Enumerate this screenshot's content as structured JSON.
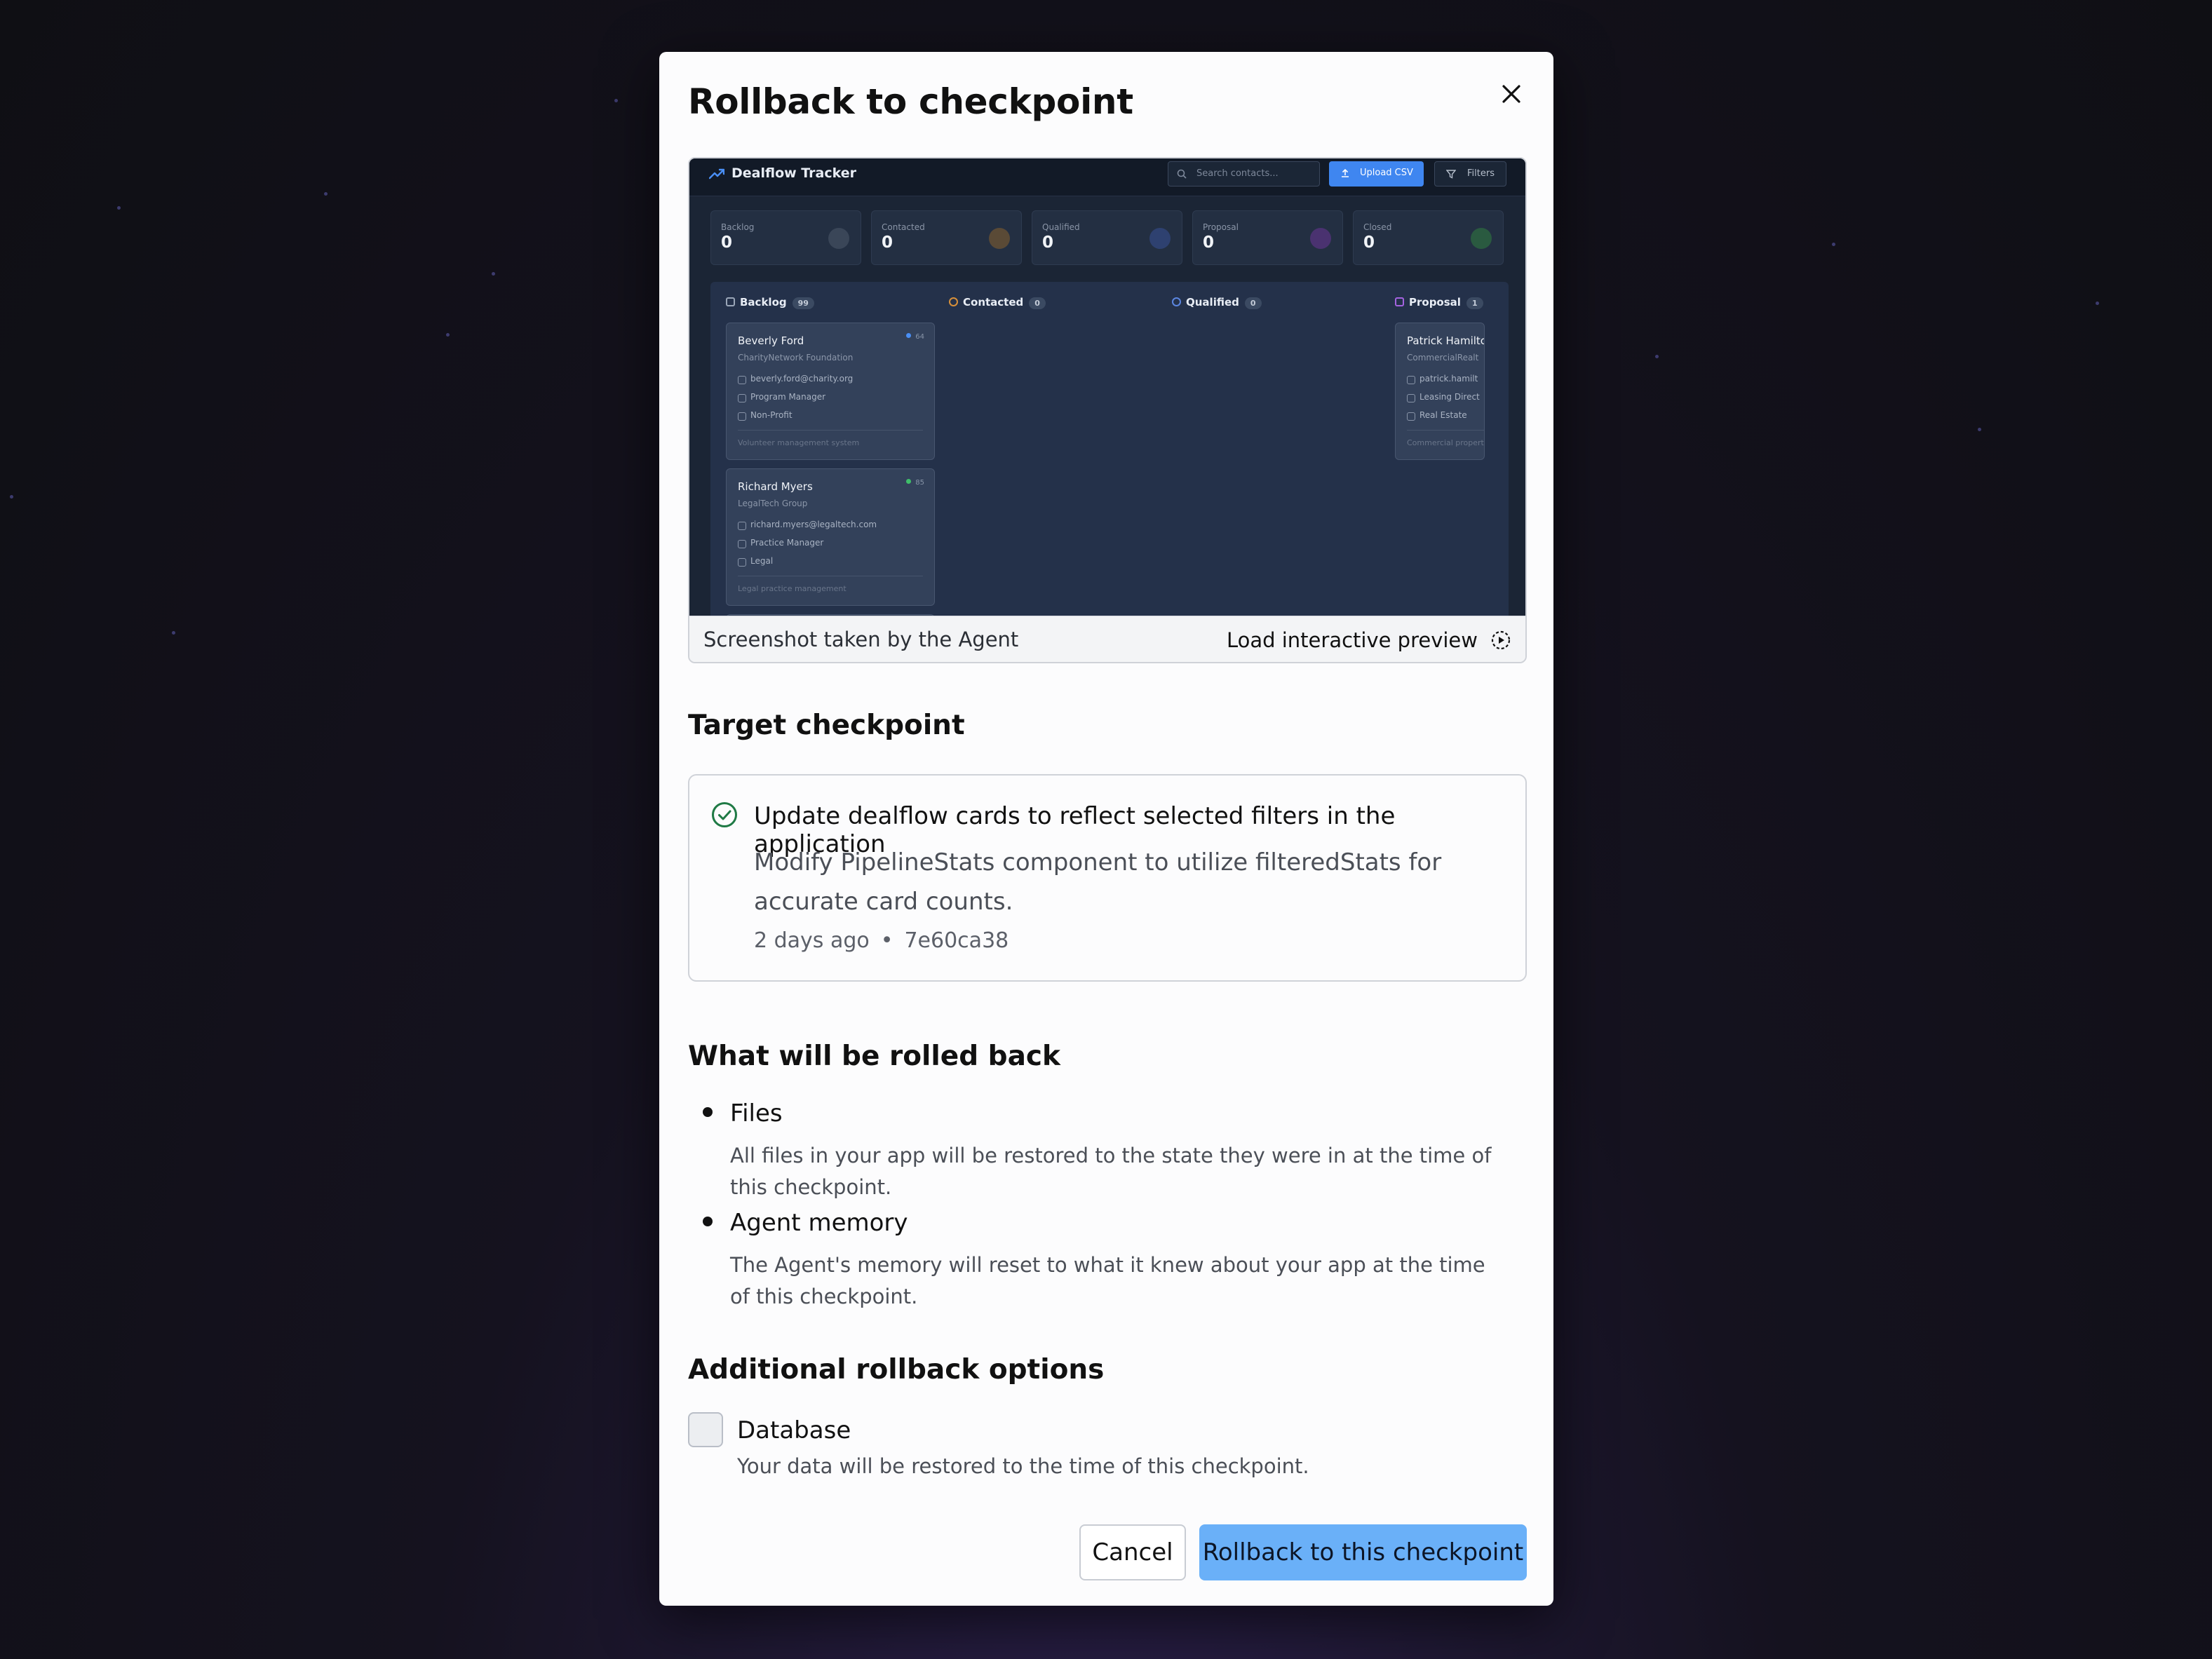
{
  "dialog": {
    "title": "Rollback to checkpoint",
    "close_icon": "close-icon"
  },
  "preview": {
    "caption": "Screenshot taken by the Agent",
    "load_label": "Load interactive preview",
    "load_icon": "play-circle-icon",
    "app": {
      "brand": "Dealflow Tracker",
      "search_placeholder": "Search contacts...",
      "upload_label": "Upload CSV",
      "filters_label": "Filters",
      "stats": [
        {
          "label": "Backlog",
          "value": "0",
          "color": "#6b7a90"
        },
        {
          "label": "Contacted",
          "value": "0",
          "color": "#b5772e"
        },
        {
          "label": "Qualified",
          "value": "0",
          "color": "#3d63b8"
        },
        {
          "label": "Proposal",
          "value": "0",
          "color": "#8a44c4"
        },
        {
          "label": "Closed",
          "value": "0",
          "color": "#2f9a5a"
        }
      ],
      "columns": [
        {
          "name": "Backlog",
          "count": "99",
          "color": "#9aa6b8"
        },
        {
          "name": "Contacted",
          "count": "0",
          "color": "#d8903a"
        },
        {
          "name": "Qualified",
          "count": "0",
          "color": "#5b86e0"
        },
        {
          "name": "Proposal",
          "count": "1",
          "color": "#a463e0"
        }
      ],
      "cards": [
        {
          "name": "Beverly Ford",
          "company": "CharityNetwork Foundation",
          "email": "beverly.ford@charity.org",
          "role": "Program Manager",
          "tag": "Non-Profit",
          "note": "Volunteer management system",
          "score": "64",
          "score_color": "#4a8ff5"
        },
        {
          "name": "Richard Myers",
          "company": "LegalTech Group",
          "email": "richard.myers@legaltech.com",
          "role": "Practice Manager",
          "tag": "Legal",
          "note": "Legal practice management",
          "score": "85",
          "score_color": "#3fbf6a"
        },
        {
          "name": "Patrick Hamiltc",
          "company": "CommercialRealt",
          "email": "patrick.hamilt",
          "role": "Leasing Direct",
          "tag": "Real Estate",
          "note": "Commercial propert"
        }
      ]
    }
  },
  "target_checkpoint": {
    "heading": "Target checkpoint",
    "title": "Update dealflow cards to reflect selected filters in the application",
    "description": "Modify PipelineStats component to utilize filteredStats for accurate card counts.",
    "time_ago": "2 days ago",
    "separator": "•",
    "commit": "7e60ca38",
    "status_icon": "check-circle-icon",
    "status_color": "#1f7a45"
  },
  "rolled_back": {
    "heading": "What will be rolled back",
    "items": [
      {
        "title": "Files",
        "description": "All files in your app will be restored to the state they were in at the time of this checkpoint."
      },
      {
        "title": "Agent memory",
        "description": "The Agent's memory will reset to what it knew about your app at the time of this checkpoint."
      }
    ]
  },
  "additional": {
    "heading": "Additional rollback options",
    "database_label": "Database",
    "database_description": "Your data will be restored to the time of this checkpoint.",
    "database_checked": false
  },
  "actions": {
    "cancel_label": "Cancel",
    "confirm_label": "Rollback to this checkpoint",
    "confirm_color": "#6ab0f8"
  }
}
